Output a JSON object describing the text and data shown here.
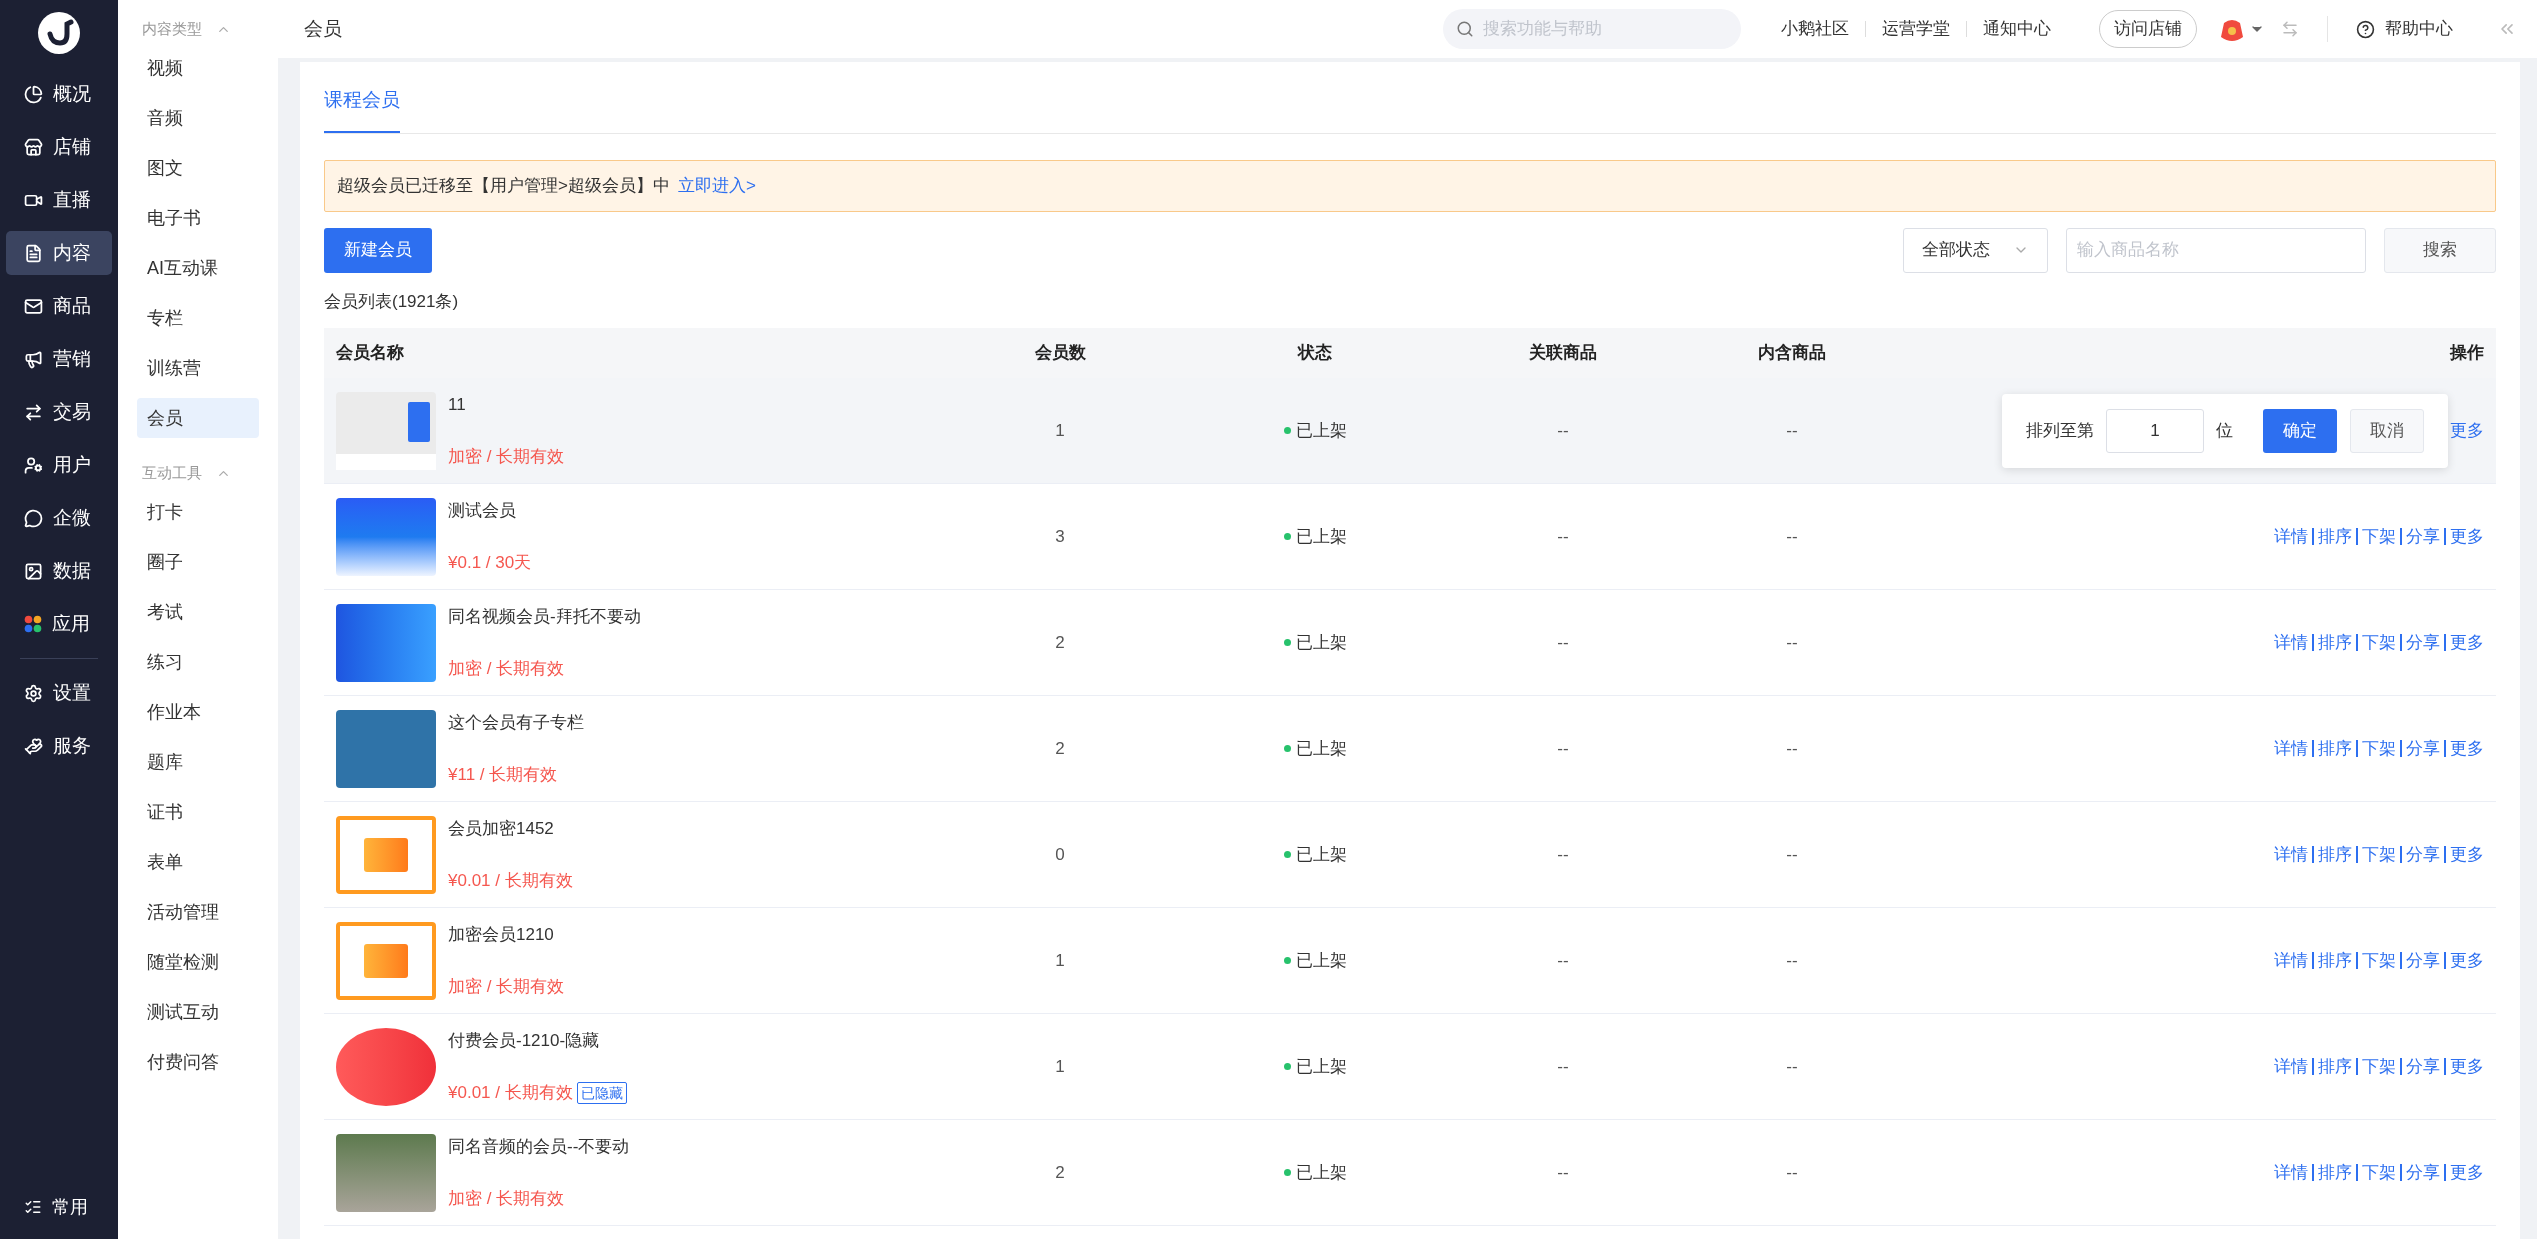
{
  "nav": {
    "items": [
      {
        "label": "概况",
        "selected": false
      },
      {
        "label": "店铺",
        "selected": false
      },
      {
        "label": "直播",
        "selected": false
      },
      {
        "label": "内容",
        "selected": true
      },
      {
        "label": "商品",
        "selected": false
      },
      {
        "label": "营销",
        "selected": false
      },
      {
        "label": "交易",
        "selected": false
      },
      {
        "label": "用户",
        "selected": false
      },
      {
        "label": "企微",
        "selected": false
      },
      {
        "label": "数据",
        "selected": false
      },
      {
        "label": "应用",
        "selected": false
      }
    ],
    "bottom_items": [
      {
        "label": "设置",
        "selected": false
      },
      {
        "label": "服务",
        "selected": false
      }
    ],
    "footer": "常用"
  },
  "sidebar": {
    "groups": [
      {
        "title": "内容类型",
        "expanded": true,
        "items": [
          {
            "label": "视频",
            "selected": false
          },
          {
            "label": "音频",
            "selected": false
          },
          {
            "label": "图文",
            "selected": false
          },
          {
            "label": "电子书",
            "selected": false
          },
          {
            "label": "AI互动课",
            "selected": false
          },
          {
            "label": "专栏",
            "selected": false
          },
          {
            "label": "训练营",
            "selected": false
          },
          {
            "label": "会员",
            "selected": true
          }
        ]
      },
      {
        "title": "互动工具",
        "expanded": true,
        "items": [
          {
            "label": "打卡",
            "selected": false
          },
          {
            "label": "圈子",
            "selected": false
          },
          {
            "label": "考试",
            "selected": false
          },
          {
            "label": "练习",
            "selected": false
          },
          {
            "label": "作业本",
            "selected": false
          },
          {
            "label": "题库",
            "selected": false
          },
          {
            "label": "证书",
            "selected": false
          },
          {
            "label": "表单",
            "selected": false
          },
          {
            "label": "活动管理",
            "selected": false
          },
          {
            "label": "随堂检测",
            "selected": false
          },
          {
            "label": "测试互动",
            "selected": false
          },
          {
            "label": "付费问答",
            "selected": false
          }
        ]
      }
    ]
  },
  "topbar": {
    "title": "会员",
    "search": {
      "placeholder": "搜索功能与帮助"
    },
    "links": [
      "小鹅社区",
      "运营学堂",
      "通知中心"
    ],
    "visit_button": "访问店铺",
    "help": "帮助中心"
  },
  "tabs": [
    {
      "label": "课程会员",
      "selected": true
    }
  ],
  "notice": {
    "text": "超级会员已迁移至【用户管理>超级会员】中",
    "link": "立即进入>"
  },
  "toolbar": {
    "new_button": "新建会员",
    "status_select": "全部状态",
    "search": {
      "placeholder": "输入商品名称"
    },
    "search_button": "搜索"
  },
  "list_title": "会员列表(1921条)",
  "table": {
    "columns": [
      "会员名称",
      "会员数",
      "状态",
      "关联商品",
      "内含商品",
      "操作"
    ],
    "rows": [
      {
        "kind": "screenshot",
        "name": "11",
        "price": "加密 / 长期有效",
        "count": "1",
        "status": "已上架",
        "related": "--",
        "contained": "--",
        "hovered": true,
        "actions": [
          "更多"
        ],
        "sort_popover": {
          "label": "排列至第",
          "value": "1",
          "unit": "位",
          "confirm": "确定",
          "cancel": "取消"
        }
      },
      {
        "kind": "banner",
        "name": "测试会员",
        "price": "¥0.1 / 30天",
        "count": "3",
        "status": "已上架",
        "related": "--",
        "contained": "--",
        "hovered": false,
        "actions": [
          "详情",
          "排序",
          "下架",
          "分享",
          "更多"
        ]
      },
      {
        "kind": "illustration",
        "name": "同名视频会员-拜托不要动",
        "price": "加密 / 长期有效",
        "count": "2",
        "status": "已上架",
        "related": "--",
        "contained": "--",
        "hovered": false,
        "actions": [
          "详情",
          "排序",
          "下架",
          "分享",
          "更多"
        ]
      },
      {
        "kind": "gears",
        "name": "这个会员有子专栏",
        "price": "¥11 / 长期有效",
        "count": "2",
        "status": "已上架",
        "related": "--",
        "contained": "--",
        "hovered": false,
        "actions": [
          "详情",
          "排序",
          "下架",
          "分享",
          "更多"
        ]
      },
      {
        "kind": "gift",
        "name": "会员加密1452",
        "price": "¥0.01 / 长期有效",
        "count": "0",
        "status": "已上架",
        "related": "--",
        "contained": "--",
        "hovered": false,
        "actions": [
          "详情",
          "排序",
          "下架",
          "分享",
          "更多"
        ]
      },
      {
        "kind": "gift",
        "name": "加密会员1210",
        "price": "加密 / 长期有效",
        "count": "1",
        "status": "已上架",
        "related": "--",
        "contained": "--",
        "hovered": false,
        "actions": [
          "详情",
          "排序",
          "下架",
          "分享",
          "更多"
        ]
      },
      {
        "kind": "flash-sale",
        "name": "付费会员-1210-隐藏",
        "price": "¥0.01 / 长期有效",
        "badge": "已隐藏",
        "count": "1",
        "status": "已上架",
        "related": "--",
        "contained": "--",
        "hovered": false,
        "actions": [
          "详情",
          "排序",
          "下架",
          "分享",
          "更多"
        ]
      },
      {
        "kind": "photo",
        "name": "同名音频的会员--不要动",
        "price": "加密 / 长期有效",
        "count": "2",
        "status": "已上架",
        "related": "--",
        "contained": "--",
        "hovered": false,
        "actions": [
          "详情",
          "排序",
          "下架",
          "分享",
          "更多"
        ]
      }
    ]
  }
}
